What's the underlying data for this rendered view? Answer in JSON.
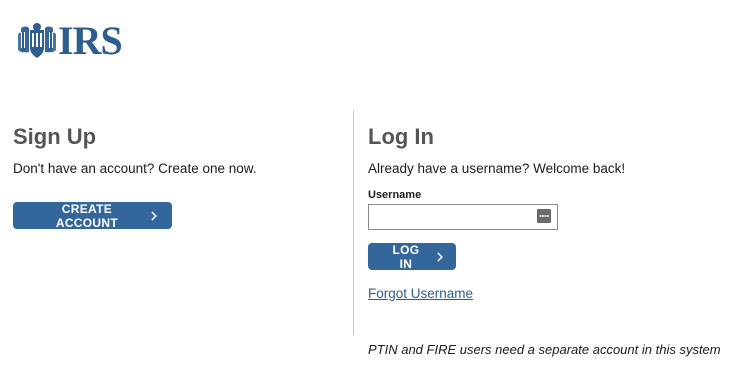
{
  "header": {
    "logo_text": "IRS",
    "logo_icon": "irs-eagle-icon",
    "brand_color": "#2e5e8e"
  },
  "signup": {
    "title": "Sign Up",
    "subtitle": "Don't have an account? Create one now.",
    "button_label": "CREATE ACCOUNT"
  },
  "login": {
    "title": "Log In",
    "subtitle": "Already have a username? Welcome back!",
    "username_label": "Username",
    "username_value": "",
    "username_placeholder": "",
    "button_label": "LOG IN",
    "forgot_link": "Forgot Username",
    "note": "PTIN and FIRE users need a separate account in this system"
  },
  "colors": {
    "button_bg": "#33669a",
    "heading": "#555555",
    "link": "#2e5e8e"
  }
}
